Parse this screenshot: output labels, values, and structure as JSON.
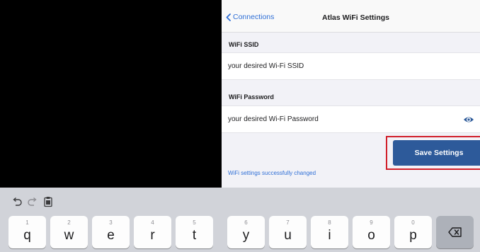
{
  "nav": {
    "back_label": "Connections",
    "title": "Atlas WiFi Settings"
  },
  "ssid": {
    "label": "WiFi SSID",
    "value": "your desired Wi-Fi SSID"
  },
  "password": {
    "label": "WiFi Password",
    "value": "your desired Wi-Fi Password"
  },
  "save_button": {
    "label": "Save Settings"
  },
  "status_message": "WiFi settings successfully changed",
  "keyboard": {
    "toolbar_icons": [
      "undo-icon",
      "redo-icon",
      "paste-icon"
    ],
    "row1": [
      {
        "num": "1",
        "char": "q"
      },
      {
        "num": "2",
        "char": "w"
      },
      {
        "num": "3",
        "char": "e"
      },
      {
        "num": "4",
        "char": "r"
      },
      {
        "num": "5",
        "char": "t"
      },
      {
        "num": "6",
        "char": "y"
      },
      {
        "num": "7",
        "char": "u"
      },
      {
        "num": "8",
        "char": "i"
      },
      {
        "num": "9",
        "char": "o"
      },
      {
        "num": "0",
        "char": "p"
      }
    ]
  },
  "colors": {
    "accent": "#2f6fd6",
    "button": "#2d5a9a",
    "highlight_frame": "#d11f2a"
  }
}
